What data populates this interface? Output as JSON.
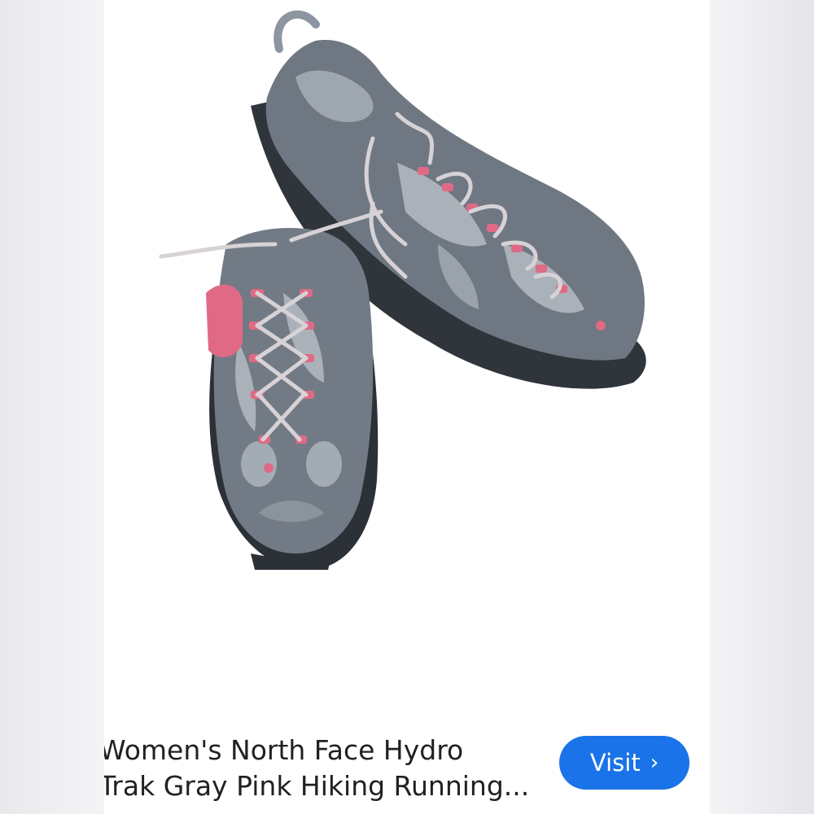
{
  "product": {
    "image_alt": "Gray and pink hiking shoes",
    "title_lines": [
      "Women's North Face Hydro",
      "Trak Gray Pink Hiking Running..."
    ]
  },
  "actions": {
    "visit_label": "Visit",
    "visit_icon": "chevron-right-icon"
  },
  "colors": {
    "button": "#1a73e8",
    "shoe_gray": "#6e7680",
    "shoe_pink": "#e06a86"
  }
}
